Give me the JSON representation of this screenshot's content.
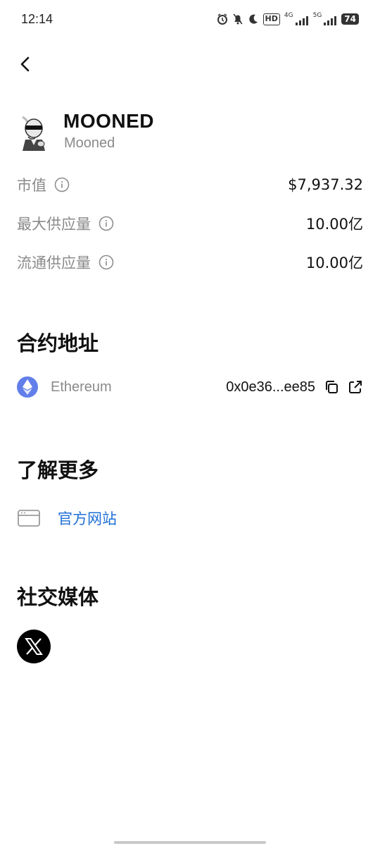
{
  "status_bar": {
    "time": "12:14",
    "icons": [
      "alarm-icon",
      "mute-icon",
      "moon-icon",
      "hd-icon",
      "4g-signal-icon",
      "5g-signal-icon",
      "battery-icon"
    ],
    "hd_label": "HD",
    "net1": "4G",
    "net2": "5G",
    "battery": "74"
  },
  "token": {
    "symbol": "MOONED",
    "name": "Mooned"
  },
  "stats": [
    {
      "label": "市值",
      "value": "$7,937.32"
    },
    {
      "label": "最大供应量",
      "value": "10.00亿"
    },
    {
      "label": "流通供应量",
      "value": "10.00亿"
    }
  ],
  "contract": {
    "title": "合约地址",
    "chain": "Ethereum",
    "address": "0x0e36...ee85"
  },
  "learn_more": {
    "title": "了解更多",
    "website_label": "官方网站"
  },
  "social": {
    "title": "社交媒体",
    "items": [
      "x-icon"
    ]
  },
  "colors": {
    "link": "#1f6fd6",
    "ethereum": "#627eea",
    "muted": "#8a8a8a"
  }
}
